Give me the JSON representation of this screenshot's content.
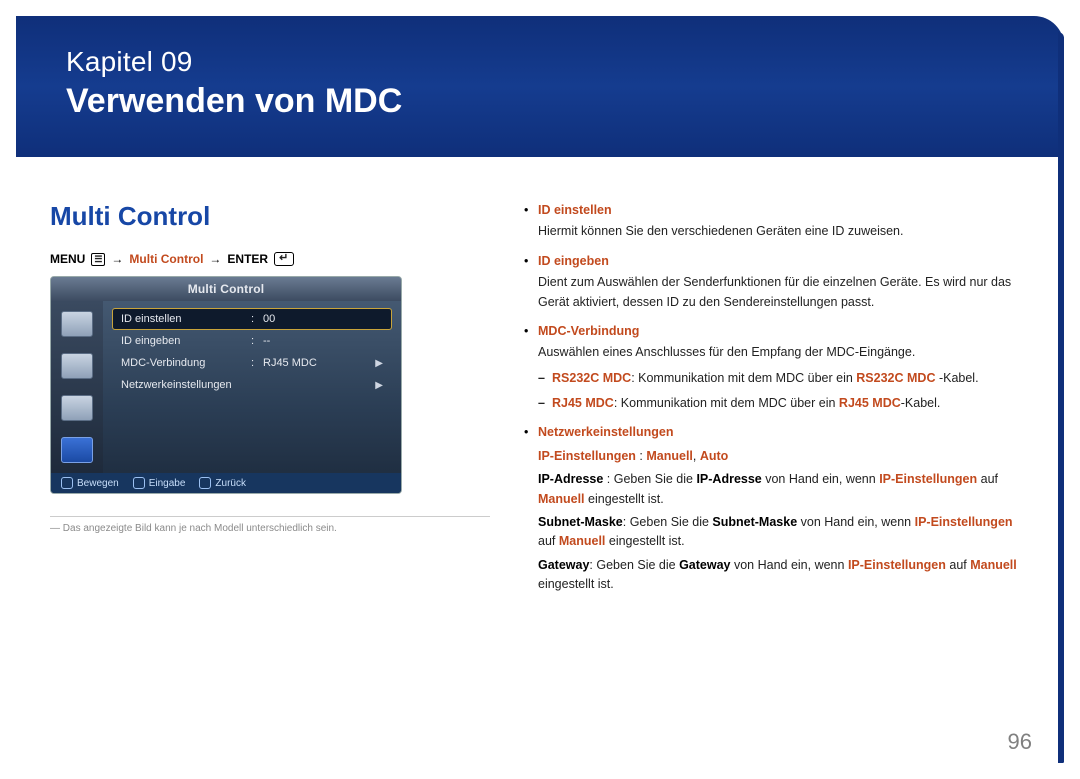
{
  "header": {
    "chapter": "Kapitel 09",
    "title": "Verwenden von MDC"
  },
  "section_heading": "Multi Control",
  "breadcrumb": {
    "menu": "MENU",
    "step1": "Multi Control",
    "enter": "ENTER"
  },
  "osd": {
    "title": "Multi Control",
    "rows": [
      {
        "label": "ID einstellen",
        "sep": ":",
        "value": "00",
        "arrow": ""
      },
      {
        "label": "ID eingeben",
        "sep": ":",
        "value": "--",
        "arrow": ""
      },
      {
        "label": "MDC-Verbindung",
        "sep": ":",
        "value": "RJ45 MDC",
        "arrow": "▶"
      },
      {
        "label": "Netzwerkeinstellungen",
        "sep": "",
        "value": "",
        "arrow": "▶"
      }
    ],
    "footer": {
      "move": "Bewegen",
      "enter": "Eingabe",
      "back": "Zurück"
    }
  },
  "footnote_prefix": "―",
  "footnote": "Das angezeigte Bild kann je nach Modell unterschiedlich sein.",
  "items": {
    "id_set": {
      "label": "ID einstellen",
      "desc": "Hiermit können Sie den verschiedenen Geräten eine ID zuweisen."
    },
    "id_enter": {
      "label": "ID eingeben",
      "desc": "Dient zum Auswählen der Senderfunktionen für die einzelnen Geräte. Es wird nur das Gerät aktiviert, dessen ID zu den Sendereinstellungen passt."
    },
    "mdc_conn": {
      "label": "MDC-Verbindung",
      "desc": "Auswählen eines Anschlusses für den Empfang der MDC-Eingänge.",
      "sub1_hl": "RS232C MDC",
      "sub1_txt_a": ": Kommunikation mit dem MDC über ein ",
      "sub1_hl2": "RS232C MDC",
      "sub1_txt_b": " -Kabel.",
      "sub2_hl": "RJ45 MDC",
      "sub2_txt_a": ": Kommunikation mit dem MDC über ein ",
      "sub2_hl2": "RJ45 MDC",
      "sub2_txt_b": "-Kabel."
    },
    "net": {
      "label": "Netzwerkeinstellungen",
      "ip_line_lbl": "IP-Einstellungen",
      "ip_line_sep": " : ",
      "ip_line_v1": "Manuell",
      "ip_line_comma": ", ",
      "ip_line_v2": "Auto",
      "ip_pre": "IP-Adresse",
      "ip_txt_a": " : Geben Sie die ",
      "ip_bold": "IP-Adresse",
      "ip_txt_b": " von Hand ein, wenn ",
      "ip_hl": "IP-Einstellungen",
      "ip_txt_c": " auf ",
      "ip_hl2": "Manuell",
      "ip_txt_d": " eingestellt ist.",
      "sn_pre": "Subnet-Maske",
      "sn_txt_a": ": Geben Sie die ",
      "sn_bold": "Subnet-Maske",
      "sn_txt_b": " von Hand ein, wenn ",
      "sn_hl": "IP-Einstellungen",
      "sn_txt_c": " auf ",
      "sn_hl2": "Manuell",
      "sn_txt_d": " eingestellt ist.",
      "gw_pre": "Gateway",
      "gw_txt_a": ": Geben Sie die ",
      "gw_bold": "Gateway",
      "gw_txt_b": " von Hand ein, wenn ",
      "gw_hl": "IP-Einstellungen",
      "gw_txt_c": " auf ",
      "gw_hl2": "Manuell",
      "gw_txt_d": " eingestellt ist."
    }
  },
  "page_number": "96"
}
